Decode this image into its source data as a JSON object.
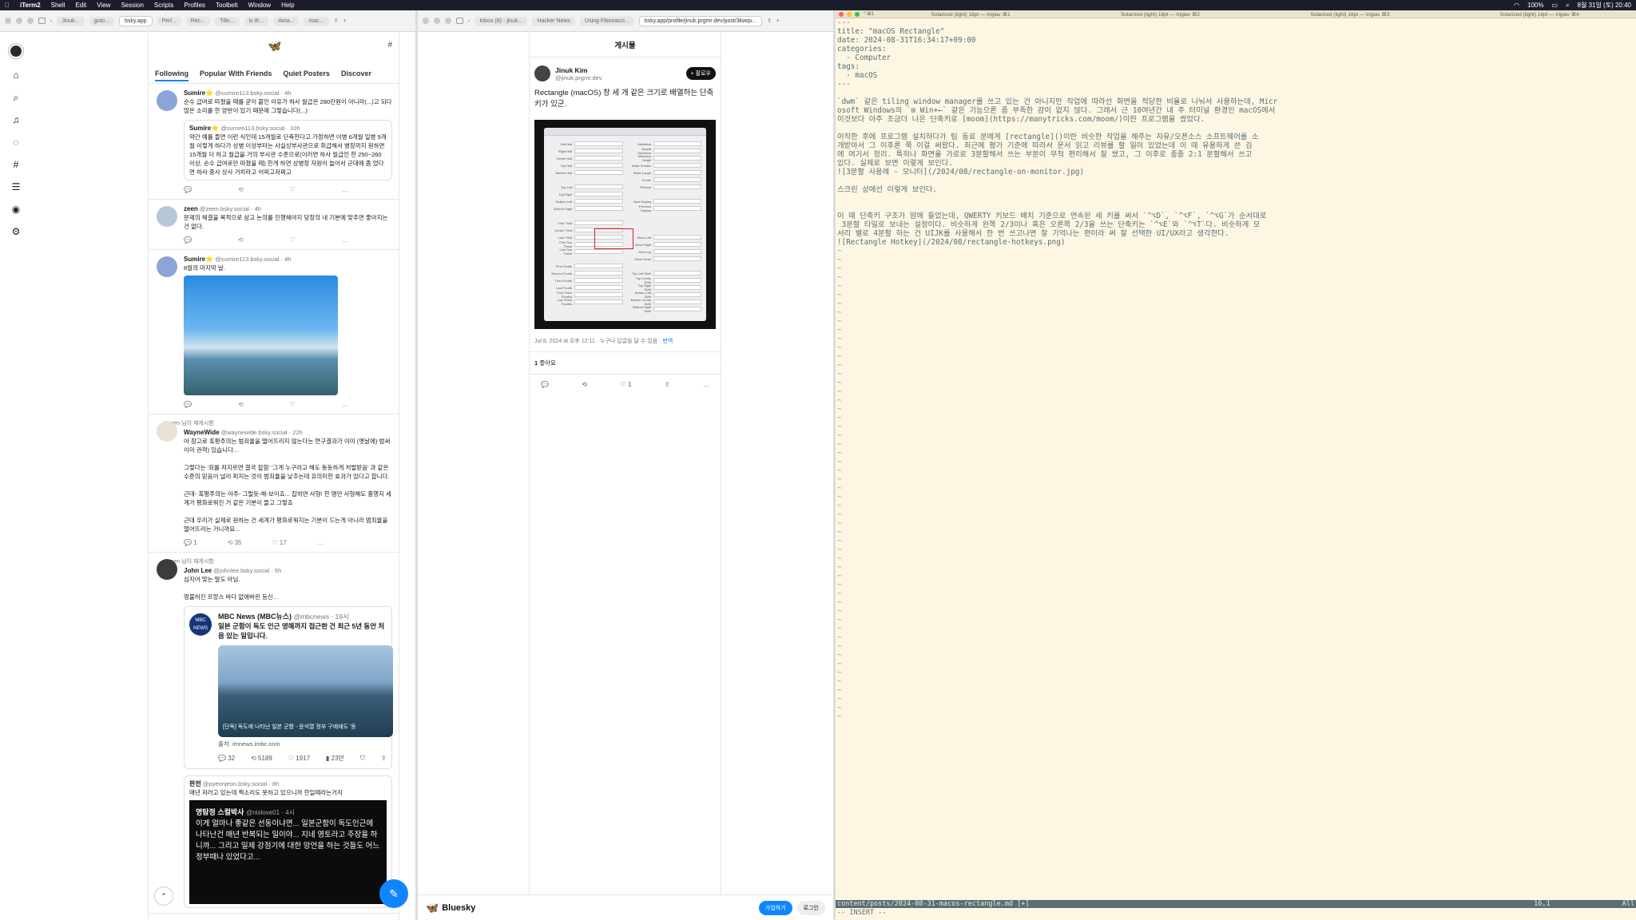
{
  "menubar": {
    "app": "iTerm2",
    "items": [
      "Shell",
      "Edit",
      "View",
      "Session",
      "Scripts",
      "Profiles",
      "Toolbelt",
      "Window",
      "Help"
    ],
    "battery": "100%",
    "datetime": "8월 31일 (토) 20:40"
  },
  "browser1": {
    "tabs": [
      "Jinuk...",
      "goto...",
      "bsky.app",
      "Perl...",
      "Rec...",
      "Tilin...",
      "is th...",
      "Ama...",
      "mac..."
    ],
    "feed_tabs": [
      "Following",
      "Popular With Friends",
      "Quiet Posters",
      "Discover"
    ],
    "posts": [
      {
        "name": "Sumire⭐",
        "handle": "@sumire113.bsky.social · 4h",
        "text": "순수 급여로 따졌을 때를 굳이 붙인 이유가 혀사 월급은 280만원이 아니라(...)고 되다 많은 소리를 한 양반이 있기 때문에 그렇습니다(...)",
        "quote": {
          "name": "Sumire⭐",
          "handle": "@sumire113.bsky.social · 10h",
          "text": "약간 예를 들면 이런 식인데 15개월로 단축한다고 가정하면 이병 6개월 일병 9개월 이렇게 하다가 상병 이상부터는 사실상부사관으로 취급해서 병장까지 원하면 15개월 더 하고 월급을 거의 부사관 수준으로(이러면 하사 월급인 한 250~260 이상, 순수 급여로만 따졌을 때) 한게 하면 상병장 자원이 늘어서 군대에 좀 었다면 하사 중사 상사 거치라고 어찌고저쩌고"
        }
      },
      {
        "name": "zeen",
        "handle": "@zeen.bsky.social · 4h",
        "text": "문제의 해결을 목적으로 삼고 논의를 진행해야지 당장의 내 기분에 맞추면 좋아지는 건 없다."
      },
      {
        "name": "Sumire⭐",
        "handle": "@sumire113.bsky.social · 4h",
        "text": "8월의 마지막 날."
      },
      {
        "repost": "zeen 님이 재게시함",
        "name": "WayneWide",
        "handle": "@waynewide.bsky.social · 22h",
        "text1": "아 참고로 혹평주의는 범죄율을 떨어뜨리지 않는다는 연구결과가 이미 (옛날에) 범써 이미 관적) 있습니다...",
        "text2": "그렇다는 '죄를 저지르면 결국 잡힘' '그게 누구라고 해도 동등하게 처벌받음' 과 같은 수준의 믿음이 널리 퍼지는 것이 범죄율을 낮추는데 유의미한 효과가 있다고 합니다.",
        "text3": "근데- 혹평주의는 아주- 그럴듯-해-보이죠... 잡히면 사형! 한 명만 사형해도 흉행지 세계가 평화로워진 거 같은 기분이 들고 그렇죠",
        "text4": "근데 우리가 실제로 원하는 건 세계가 평화로워지는 기분이 드는게 아니라 범죄율을 떨어뜨리는 거니까요...",
        "replies": "1",
        "reposts": "35",
        "likes": "17"
      },
      {
        "repost": "zeen 님이 재게시함",
        "name": "John Lee",
        "handle": "@johnlee.bsky.social · 5h",
        "text": "심지어 맞는 말도 아님.",
        "text2": "멍불허진 프랑스 바다 없애버린 등신..."
      }
    ],
    "mbc": {
      "name": "MBC News (MBC뉴스)",
      "handle": "@mbcnews · 19시",
      "headline": "일본 군함이 독도 인근 영해까지 접근한 건 최근 5년 동안 처음 있는 일입니다.",
      "caption": "[단독] 독도에 나타난 일본 군함 - 윤석열 정부 구애에도 '동",
      "source": "출처: imnews.imbc.com",
      "replies": "32",
      "reposts": "5189",
      "likes": "1917",
      "views": "23만"
    },
    "q3": {
      "name": "판전",
      "handle": "@pyeonjeon.bsky.social · 8h",
      "text": "매년 저러고 있는데 찍소리도 못하고 있으니까 한일때라는거지",
      "inner_name": "명탐정 스컬박사",
      "inner_handle": "@nislove01 · 4시",
      "inner_text": "이게 얼마나 좋같은 선동이냐면... 일본군함이 독도인근에 나타난건 매년 반복되는 일이야... 지네 영토라고 주장을 하니까... 그리고 일제 강점기에 대한 망언을 하는 것들도 어느 정부때나 있었다고..."
    }
  },
  "browser2": {
    "tabs": [
      "Inbox (8) - jinuk...",
      "Hacker News",
      "Using Fibonacci...",
      "bsky.app/profile/jinuk.prgmr.dev/post/3kwqv..."
    ],
    "page_title": "게시물",
    "author_name": "Jinuk Kim",
    "author_handle": "@jinuk.prgmr.dev",
    "follow": "+ 팔로우",
    "text": "Rectangle (macOS) 창 세 개 같은 크기로 배열하는 단축키가 있군.",
    "meta": "Jul 8, 2024 at 오후 12:11 · 누구나 답글을 달 수 있음 · ",
    "meta_link": "번역",
    "likes": "1",
    "likes_label": " 좋아요",
    "like_count": "1",
    "footer_brand": "Bluesky",
    "signup": "가입하기",
    "login": "로그인",
    "shot_rows_left": [
      "Left Half",
      "Right Half",
      "Center Half",
      "Top Half",
      "Bottom Half",
      "",
      "Top Left",
      "Top Right",
      "Bottom Left",
      "Bottom Right",
      "",
      "First Third",
      "Center Third",
      "Last Third",
      "First Two Thirds",
      "Last Two Thirds",
      "",
      "First Fourth",
      "Second Fourth",
      "Third Fourth",
      "Last Fourth",
      "First Three Fourths",
      "Last Three Fourths"
    ],
    "shot_rows_right": [
      "Maximize",
      "Almost Maximize",
      "Maximize Height",
      "Make Smaller",
      "Make Larger",
      "Center",
      "Restore",
      "",
      "Next Display",
      "Previous Display",
      "",
      "",
      "",
      "Move Left",
      "Move Right",
      "Move Up",
      "Move Down",
      "",
      "Top Left Sixth",
      "Top Center Sixth",
      "Top Right Sixth",
      "Bottom Left Sixth",
      "Bottom Center Sixth",
      "Bottom Right Sixth"
    ]
  },
  "terminal": {
    "tabs": [
      "Solarized (light) 18pt — triglav",
      "Solarized (light) 18pt — triglav",
      "Solarized (light) 18pt — triglav",
      "Solarized (light) 18pt — triglav"
    ],
    "tab_keys": [
      "⌃⌘1",
      "⌘1",
      "⌘2",
      "⌘3",
      "⌘4"
    ],
    "lines": [
      "---",
      "title: \"macOS Rectangle\"",
      "date: 2024-08-31T16:34:17+09:00",
      "categories:",
      "  - Computer",
      "tags:",
      "  - macOS",
      "---",
      "",
      "`dwm` 같은 tiling window manager를 쓰고 있는 건 아니지만 작업에 따라선 화면을 적당한 비율로 나눠서 사용하는데, Micr",
      "osoft Windows의 `⊞ Win+←` 같은 기능으론 좀 부족한 감이 없지 않다. 그래서 근 10여년간 내 주 터미널 환경인 macOS에서",
      "이것보다 아주 조금더 나은 단축키로 [moom](https://manytricks.com/moom/)이란 프로그램을 썼었다.",
      "",
      "이직한 후에 프로그램 설치하다가 팀 동료 분에게 [rectangle]()이란 비슷한 작업을 해주는 자유/오픈소스 소프트웨어를 소",
      "개받아서 그 이후론 쭉 이걸 써왔다. 최근에 평가 기준에 따라서 문서 읽고 리뷰를 할 일이 있었는데 이 때 유용하게 쓴 김",
      "에 여기서 정리. 특히나 화면을 가로로 3분할해서 쓰는 부분이 무척 편리해서 잘 썼고, 그 이후로 종종 2:1 분할해서 쓰고",
      "있다. 실제로 보면 이렇게 보인다.",
      "![3분할 사용례 - 모니터](/2024/08/rectangle-on-monitor.jpg)",
      "",
      "스크린 상에선 이렇게 보인다.",
      "",
      "",
      "이 때 단축키 구조가 맘에 들었는데, QWERTY 키보드 배치 기준으로 연속된 세 키를 써서 `^⌥D`, `^⌥F`, `^⌥G`가 순서대로",
      " 3분할 타일로 보내는 설정이다. 비슷하게 왼쪽 2/3이나 혹은 오른쪽 2/3을 쓰는 단축키는 `^⌥E`와 `^⌥T`다. 비슷하게 모",
      "서리 별로 4분할 하는 건 UIJK를 사용해서 한 번 쓰고나면 잘 기억나는 편이라 써 잘 선택한 UI/UX라고 생각한다.",
      "![Rectangle Hotkey](/2024/08/rectangle-hotkeys.png)"
    ],
    "tilde_count": 54,
    "tilde": "~",
    "status_file": "content/posts/2024-08-31-macos-rectangle.md [+]",
    "status_pos": "16,1",
    "status_all": "All",
    "mode": "-- INSERT --"
  }
}
